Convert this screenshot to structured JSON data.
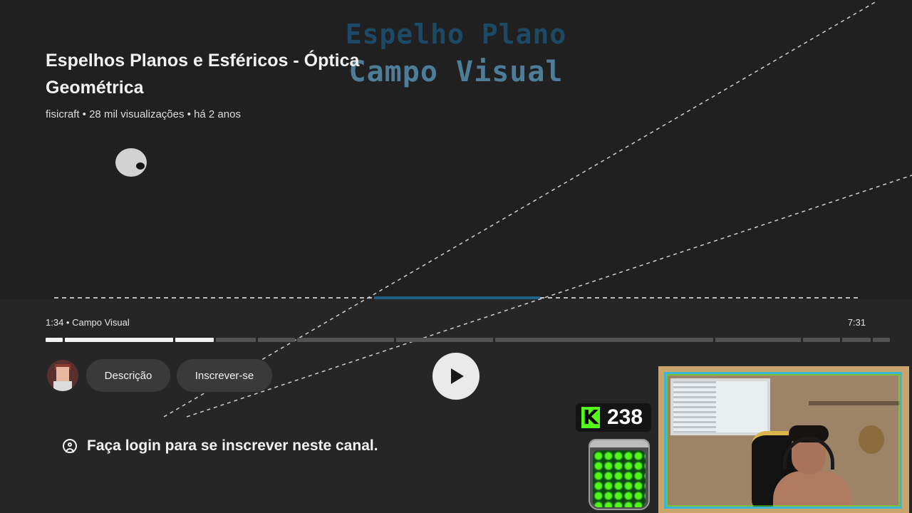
{
  "video": {
    "title": "Espelhos Planos e Esféricos - Óptica Geométrica",
    "meta": "fisicraft • 28 mil visualizações • há 2 anos",
    "overlay_title_1": "Espelho Plano",
    "overlay_title_2": "Campo Visual"
  },
  "player": {
    "chapter_label": "1:34 • Campo Visual",
    "duration": "7:31",
    "play_icon": "play-icon",
    "chapter_segments": [
      {
        "fill": 1.0
      },
      {
        "fill": 1.0
      },
      {
        "fill": 1.0
      },
      {
        "fill": 0.0
      },
      {
        "fill": 0.0
      },
      {
        "fill": 0.0
      },
      {
        "fill": 0.0
      },
      {
        "fill": 0.0
      },
      {
        "fill": 0.0
      },
      {
        "fill": 0.0
      },
      {
        "fill": 0.0
      },
      {
        "fill": 0.0
      }
    ]
  },
  "actions": {
    "description_label": "Descrição",
    "subscribe_label": "Inscrever-se",
    "login_prompt": "Faça login para se inscrever neste canal.",
    "login_icon": "account-circle-icon"
  },
  "overlay": {
    "kick_count": "238",
    "kick_logo": "K",
    "accent": "#53fc18"
  }
}
